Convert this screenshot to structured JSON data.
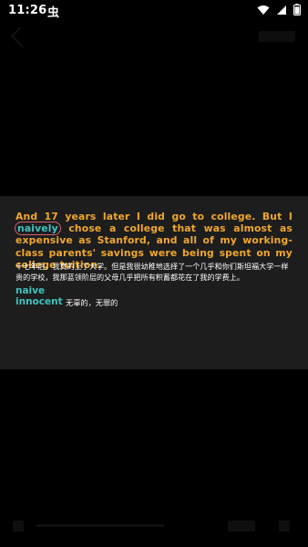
{
  "status_bar": {
    "time": "11:26",
    "app_glyph": "虫",
    "icons": [
      "wifi-icon",
      "signal-icon",
      "battery-icon"
    ],
    "battery_level": 0.9
  },
  "subtitle": {
    "english_before": "And 17 years later I did go to college. But I ",
    "highlight": "naively",
    "english_after": " chose a college that was almost as expensive as Stanford, and all of my working-class parents' savings were being spent on my college tuition.",
    "chinese": "十七年后，我真的上了大学。但是我很幼稚地选择了一个几乎和你们斯坦福大学一样贵的学校，我那蓝领阶层的父母几乎把所有积蓄都花在了我的学费上。"
  },
  "dictionary": {
    "headword": "naive",
    "related_word": "innocent",
    "related_meaning": "无辜的，无罪的"
  },
  "colors": {
    "english_text": "#efa72c",
    "highlight_text": "#3fc3c0",
    "highlight_ring": "#d6606f",
    "panel": "#1d1d1d",
    "background": "#000000"
  }
}
